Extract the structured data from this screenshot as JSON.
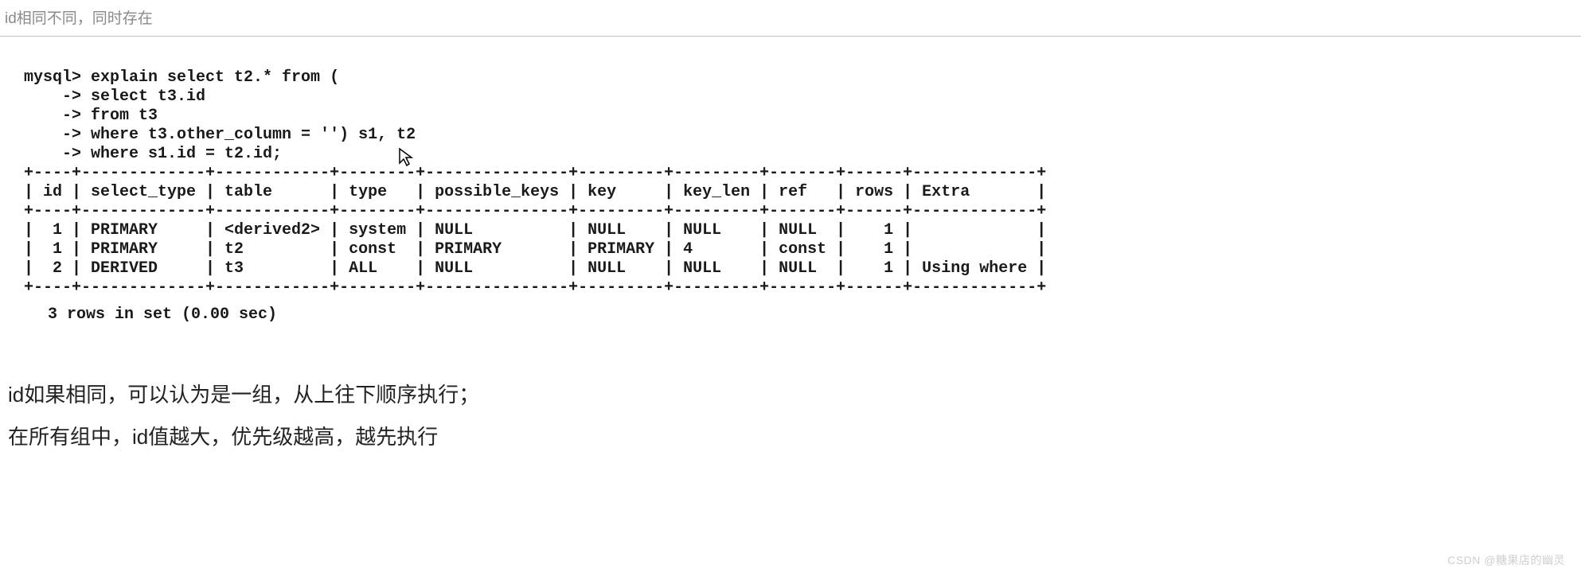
{
  "caption": "id相同不同，同时存在",
  "sql": {
    "prompt": "mysql>",
    "continuation": "->",
    "lines": [
      "explain select t2.* from (",
      "select t3.id",
      "from t3",
      "where t3.other_column = '') s1, t2",
      "where s1.id = t2.id;"
    ]
  },
  "table": {
    "headers": [
      "id",
      "select_type",
      "table",
      "type",
      "possible_keys",
      "key",
      "key_len",
      "ref",
      "rows",
      "Extra"
    ],
    "rows": [
      [
        "1",
        "PRIMARY",
        "<derived2>",
        "system",
        "NULL",
        "NULL",
        "NULL",
        "NULL",
        "1",
        ""
      ],
      [
        "1",
        "PRIMARY",
        "t2",
        "const",
        "PRIMARY",
        "PRIMARY",
        "4",
        "const",
        "1",
        ""
      ],
      [
        "2",
        "DERIVED",
        "t3",
        "ALL",
        "NULL",
        "NULL",
        "NULL",
        "NULL",
        "1",
        "Using where"
      ]
    ]
  },
  "summary": "3 rows in set (0.00 sec)",
  "explain_paragraphs": [
    "id如果相同，可以认为是一组，从上往下顺序执行；",
    "在所有组中，id值越大，优先级越高，越先执行"
  ],
  "watermark": "CSDN @糖果店的幽灵"
}
